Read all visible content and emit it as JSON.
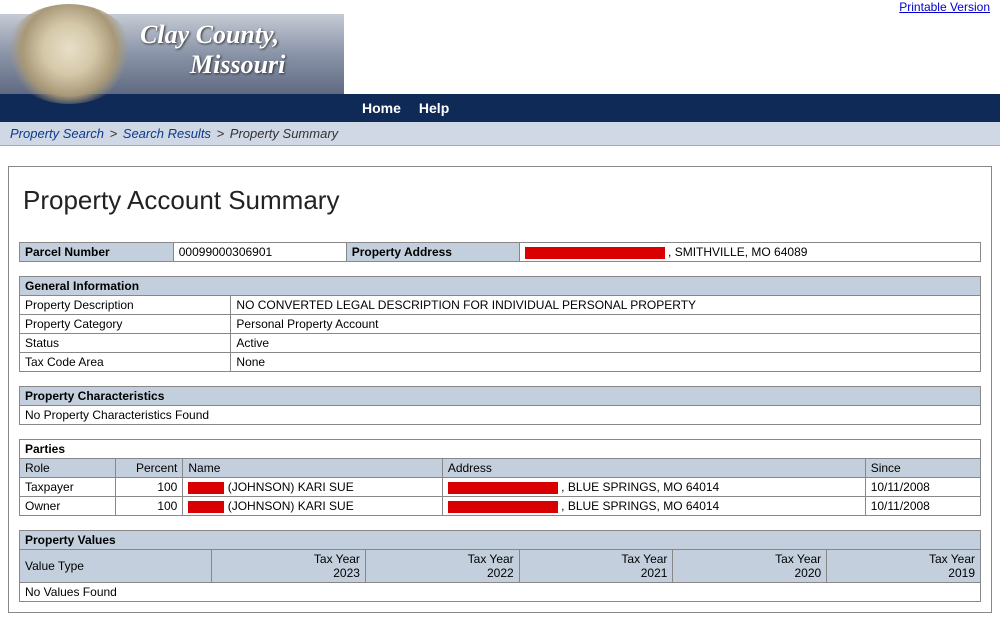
{
  "top_links": {
    "printable": "Printable Version"
  },
  "banner": {
    "line1": "Clay County,",
    "line2": "Missouri"
  },
  "nav": {
    "home": "Home",
    "help": "Help"
  },
  "breadcrumb": {
    "search": "Property Search",
    "results": "Search Results",
    "current": "Property Summary"
  },
  "page_title": "Property Account Summary",
  "parcel": {
    "parcel_label": "Parcel Number",
    "parcel_value": "00099000306901",
    "address_label": "Property Address",
    "address_suffix": ", SMITHVILLE, MO 64089"
  },
  "general": {
    "header": "General Information",
    "rows": [
      {
        "label": "Property Description",
        "value": "NO CONVERTED LEGAL DESCRIPTION FOR INDIVIDUAL PERSONAL PROPERTY"
      },
      {
        "label": "Property Category",
        "value": "Personal Property Account"
      },
      {
        "label": "Status",
        "value": "Active"
      },
      {
        "label": "Tax Code Area",
        "value": "None"
      }
    ]
  },
  "characteristics": {
    "header": "Property Characteristics",
    "none": "No Property Characteristics Found"
  },
  "parties": {
    "header": "Parties",
    "cols": {
      "role": "Role",
      "percent": "Percent",
      "name": "Name",
      "address": "Address",
      "since": "Since"
    },
    "rows": [
      {
        "role": "Taxpayer",
        "percent": "100",
        "name_suffix": " (JOHNSON) KARI SUE",
        "addr_suffix": ", BLUE SPRINGS, MO 64014",
        "since": "10/11/2008"
      },
      {
        "role": "Owner",
        "percent": "100",
        "name_suffix": " (JOHNSON) KARI SUE",
        "addr_suffix": ", BLUE SPRINGS, MO 64014",
        "since": "10/11/2008"
      }
    ]
  },
  "values": {
    "header": "Property Values",
    "value_type": "Value Type",
    "years": [
      "Tax Year\n2023",
      "Tax Year\n2022",
      "Tax Year\n2021",
      "Tax Year\n2020",
      "Tax Year\n2019"
    ],
    "none": "No Values Found"
  }
}
